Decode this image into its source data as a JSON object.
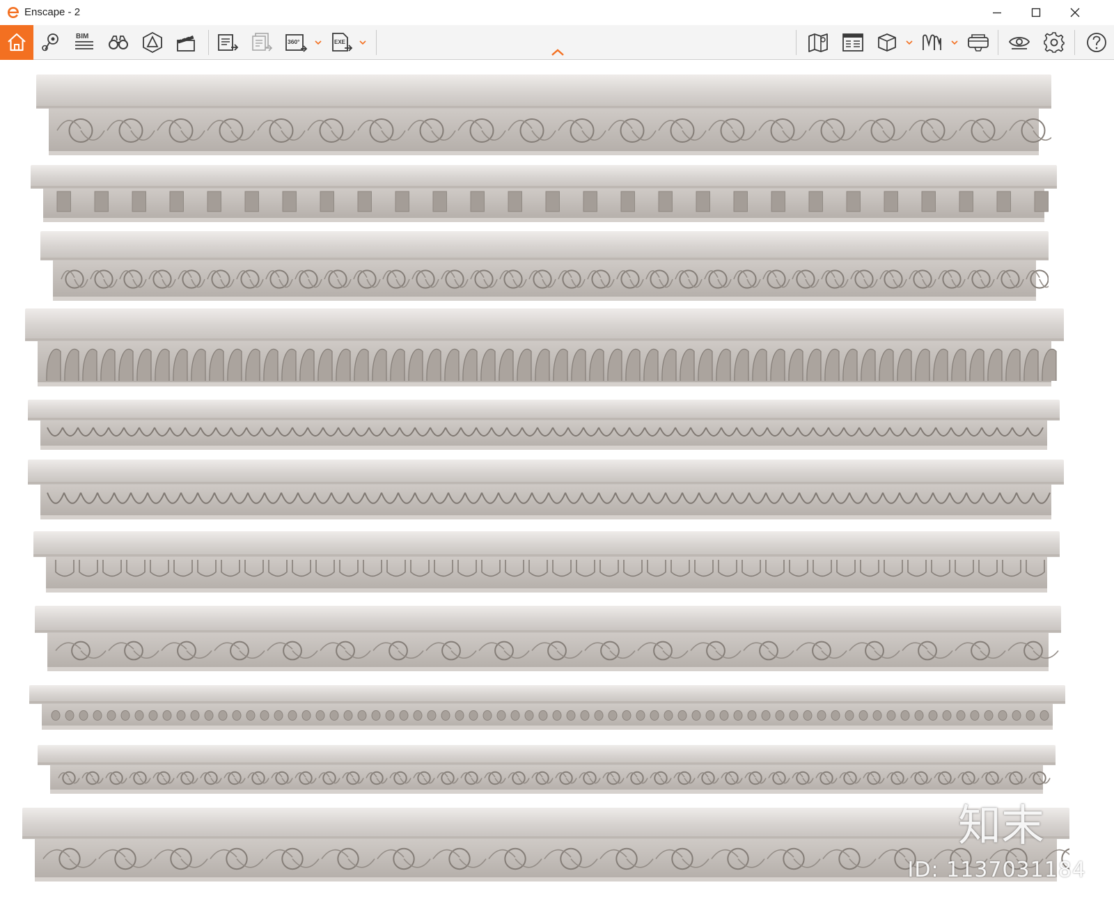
{
  "window": {
    "title": "Enscape - 2",
    "controls": [
      "minimize",
      "maximize",
      "close"
    ]
  },
  "toolbar": {
    "left_tools": [
      {
        "name": "home",
        "icon": "home-icon",
        "active": true
      },
      {
        "name": "views",
        "icon": "location-pin-icon"
      },
      {
        "name": "bim",
        "icon": "bim-icon",
        "label": "BIM"
      },
      {
        "name": "binoculars",
        "icon": "binoculars-icon"
      },
      {
        "name": "assets",
        "icon": "asset-library-icon"
      },
      {
        "name": "video-editor",
        "icon": "clapperboard-icon"
      },
      {
        "name": "render-screenshot",
        "icon": "render-image-icon"
      },
      {
        "name": "batch-render",
        "icon": "batch-render-icon"
      },
      {
        "name": "panorama",
        "icon": "panorama-360-icon",
        "label": "360°",
        "has_dropdown": true
      },
      {
        "name": "export-exe",
        "icon": "export-exe-icon",
        "label": "EXE",
        "has_dropdown": true
      }
    ],
    "right_tools": [
      {
        "name": "map",
        "icon": "map-icon"
      },
      {
        "name": "bim-info",
        "icon": "info-panel-icon"
      },
      {
        "name": "section-box",
        "icon": "cube-icon",
        "has_dropdown": true
      },
      {
        "name": "materials",
        "icon": "materials-icon",
        "has_dropdown": true
      },
      {
        "name": "vr",
        "icon": "vr-headset-icon"
      },
      {
        "name": "visual-settings",
        "icon": "eye-icon"
      },
      {
        "name": "settings",
        "icon": "gear-icon"
      },
      {
        "name": "help",
        "icon": "help-icon"
      }
    ],
    "accent_color": "#f37021"
  },
  "watermark": {
    "brand": "知末",
    "id_text": "ID: 1137031184"
  },
  "moldings_count": 11
}
